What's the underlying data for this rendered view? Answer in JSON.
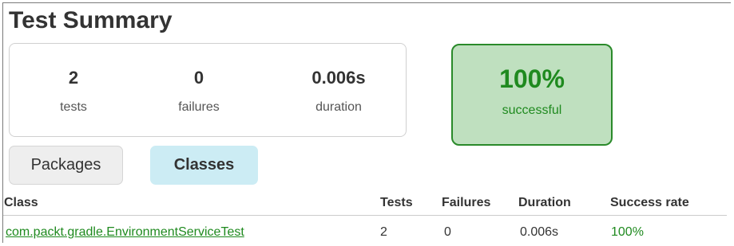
{
  "title": "Test Summary",
  "summary": {
    "tests": {
      "value": "2",
      "label": "tests"
    },
    "failures": {
      "value": "0",
      "label": "failures"
    },
    "duration": {
      "value": "0.006s",
      "label": "duration"
    },
    "success": {
      "value": "100%",
      "label": "successful"
    }
  },
  "tabs": [
    {
      "label": "Packages",
      "active": false
    },
    {
      "label": "Classes",
      "active": true
    }
  ],
  "table": {
    "columns": [
      "Class",
      "Tests",
      "Failures",
      "Duration",
      "Success rate"
    ],
    "rows": [
      {
        "class": "com.packt.gradle.EnvironmentServiceTest",
        "tests": "2",
        "failures": "0",
        "duration": "0.006s",
        "success_rate": "100%"
      }
    ]
  },
  "colors": {
    "success_green": "#1f8a1f",
    "success_bg": "#bfe0bf",
    "active_tab_bg": "#ccecf4",
    "inactive_tab_bg": "#eeeeee"
  }
}
